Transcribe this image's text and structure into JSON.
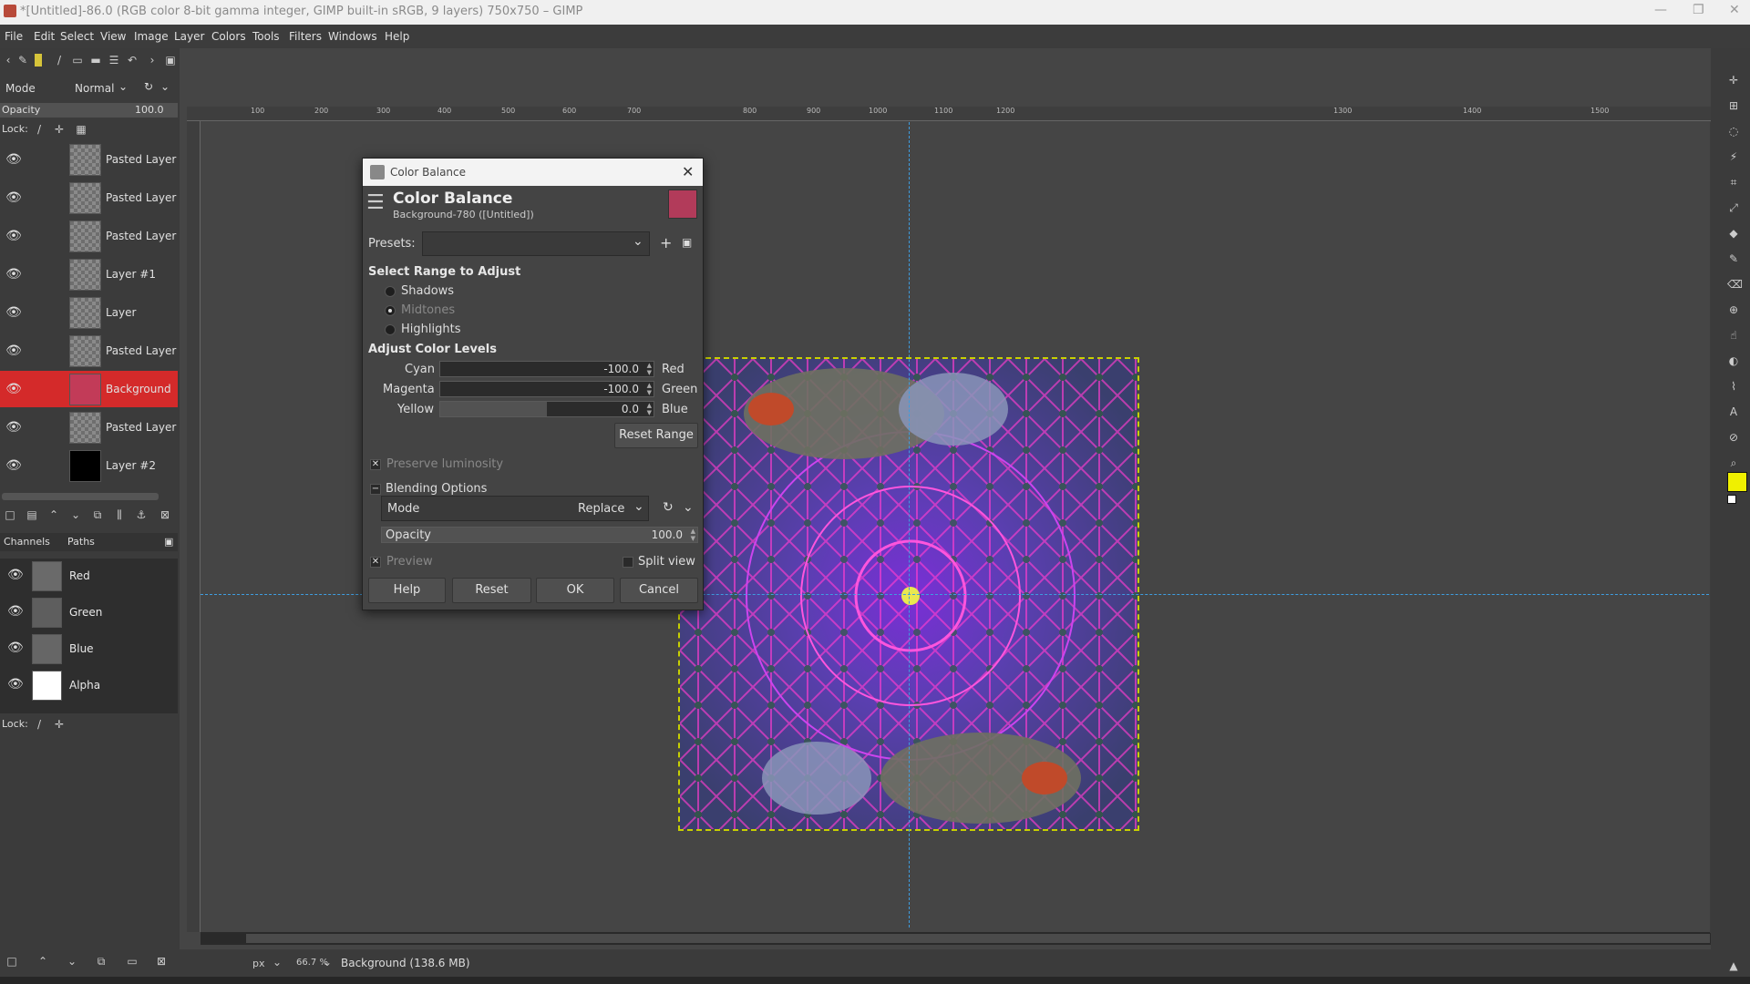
{
  "window": {
    "title": "*[Untitled]-86.0 (RGB color 8-bit gamma integer, GIMP built-in sRGB, 9 layers) 750x750 – GIMP"
  },
  "menu": [
    "File",
    "Edit",
    "Select",
    "View",
    "Image",
    "Layer",
    "Colors",
    "Tools",
    "Filters",
    "Windows",
    "Help"
  ],
  "tool_options": {
    "mode_label": "Mode",
    "mode_value": "Normal",
    "opacity_label": "Opacity",
    "opacity_value": "100.0",
    "lock_label": "Lock:"
  },
  "layers": [
    {
      "name": "Pasted Layer"
    },
    {
      "name": "Pasted Layer"
    },
    {
      "name": "Pasted Layer"
    },
    {
      "name": "Layer #1"
    },
    {
      "name": "Layer"
    },
    {
      "name": "Pasted Layer"
    },
    {
      "name": "Background",
      "selected": true
    },
    {
      "name": "Pasted Layer"
    },
    {
      "name": "Layer #2"
    }
  ],
  "channels_tabs": {
    "channels": "Channels",
    "paths": "Paths"
  },
  "channels": [
    {
      "name": "Red"
    },
    {
      "name": "Green"
    },
    {
      "name": "Blue"
    },
    {
      "name": "Alpha"
    }
  ],
  "channels_lock_label": "Lock:",
  "ruler_ticks": [
    "100",
    "200",
    "300",
    "400",
    "500",
    "600",
    "700",
    "800",
    "900",
    "1000",
    "1100",
    "1200",
    "1300",
    "1400",
    "1500"
  ],
  "dialog": {
    "window_title": "Color Balance",
    "header_title": "Color Balance",
    "header_subtitle": "Background-780 ([Untitled])",
    "presets_label": "Presets:",
    "range_heading": "Select Range to Adjust",
    "ranges": [
      "Shadows",
      "Midtones",
      "Highlights"
    ],
    "selected_range": "Midtones",
    "levels_heading": "Adjust Color Levels",
    "sliders": [
      {
        "left": "Cyan",
        "right": "Red",
        "value": "-100.0",
        "level": -100
      },
      {
        "left": "Magenta",
        "right": "Green",
        "value": "-100.0",
        "level": -100
      },
      {
        "left": "Yellow",
        "right": "Blue",
        "value": "0.0",
        "level": 0
      }
    ],
    "reset_range": "Reset Range",
    "preserve_luminosity": "Preserve luminosity",
    "blending_options": "Blending Options",
    "mode_label": "Mode",
    "mode_value": "Replace",
    "opacity_label": "Opacity",
    "opacity_value": "100.0",
    "preview": "Preview",
    "split_view": "Split view",
    "buttons": {
      "help": "Help",
      "reset": "Reset",
      "ok": "OK",
      "cancel": "Cancel"
    }
  },
  "status": {
    "unit": "px",
    "zoom": "66.7 %",
    "info": "Background (138.6 MB)"
  },
  "colors": {
    "selected_layer": "#d42a2a",
    "foreground": "#f0f000",
    "guide": "#3e9de0"
  }
}
